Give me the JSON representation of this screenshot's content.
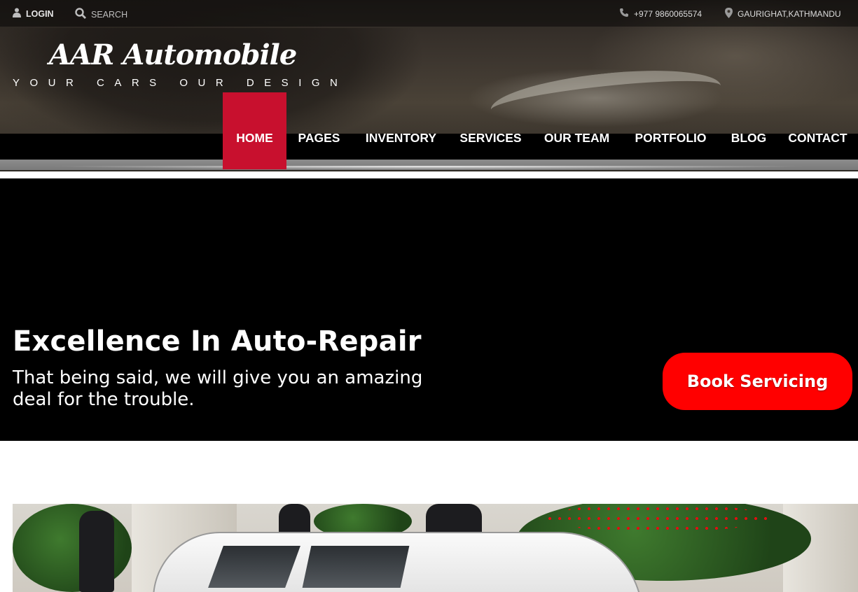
{
  "topbar": {
    "login_label": "LOGIN",
    "search_label": "SEARCH",
    "phone": "+977 9860065574",
    "address": "GAURIGHAT,KATHMANDU"
  },
  "brand": {
    "name": "AAR Automobile",
    "tagline": "YOUR CARS OUR DESIGN"
  },
  "nav": {
    "items": [
      {
        "label": "HOME",
        "active": true
      },
      {
        "label": "PAGES"
      },
      {
        "label": "INVENTORY"
      },
      {
        "label": "SERVICES"
      },
      {
        "label": "OUR TEAM"
      },
      {
        "label": "PORTFOLIO"
      },
      {
        "label": "BLOG"
      },
      {
        "label": "CONTACT"
      }
    ]
  },
  "hero": {
    "title": "Excellence In Auto-Repair",
    "subtitle": "That being said, we will give you an amazing deal for the trouble.",
    "cta_label": "Book Servicing"
  },
  "colors": {
    "nav_active": "#c8102e",
    "cta": "#ff0000",
    "hero_bg": "#000000"
  },
  "icons": {
    "login": "user-icon",
    "search": "search-icon",
    "phone": "phone-icon",
    "address": "map-pin-icon"
  }
}
